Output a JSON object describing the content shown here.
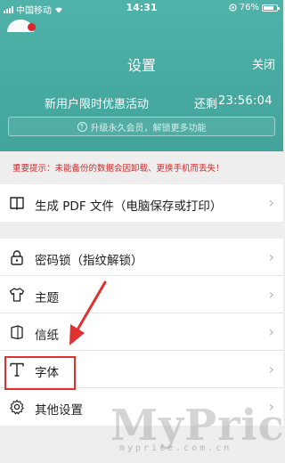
{
  "status_bar": {
    "carrier": "中国移动",
    "time": "14:31",
    "battery": "76%",
    "battery_level": 0.76
  },
  "header": {
    "title": "设置",
    "close_label": "关闭"
  },
  "promo": {
    "text": "新用户限时优惠活动",
    "countdown_label": "还剩",
    "countdown": "23:56:04",
    "upgrade_label": "升级永久会员，解锁更多功能"
  },
  "warning": "重要提示：未能备份的数据会因卸载、更换手机而丢失！",
  "menu_group_1": [
    {
      "label": "生成 PDF 文件（电脑保存或打印）",
      "icon": "book-icon"
    }
  ],
  "menu_group_2": [
    {
      "label": "密码锁（指纹解锁）",
      "icon": "lock-icon"
    },
    {
      "label": "主题",
      "icon": "tshirt-icon"
    },
    {
      "label": "信纸",
      "icon": "paper-icon"
    },
    {
      "label": "字体",
      "icon": "font-icon"
    },
    {
      "label": "其他设置",
      "icon": "gear-icon"
    }
  ],
  "colors": {
    "header": "#47aaa0",
    "warning": "#d32a2a",
    "annotation": "#e0312f"
  },
  "watermark": {
    "big": "MyPrice",
    "small": "myprice.com.cn"
  }
}
